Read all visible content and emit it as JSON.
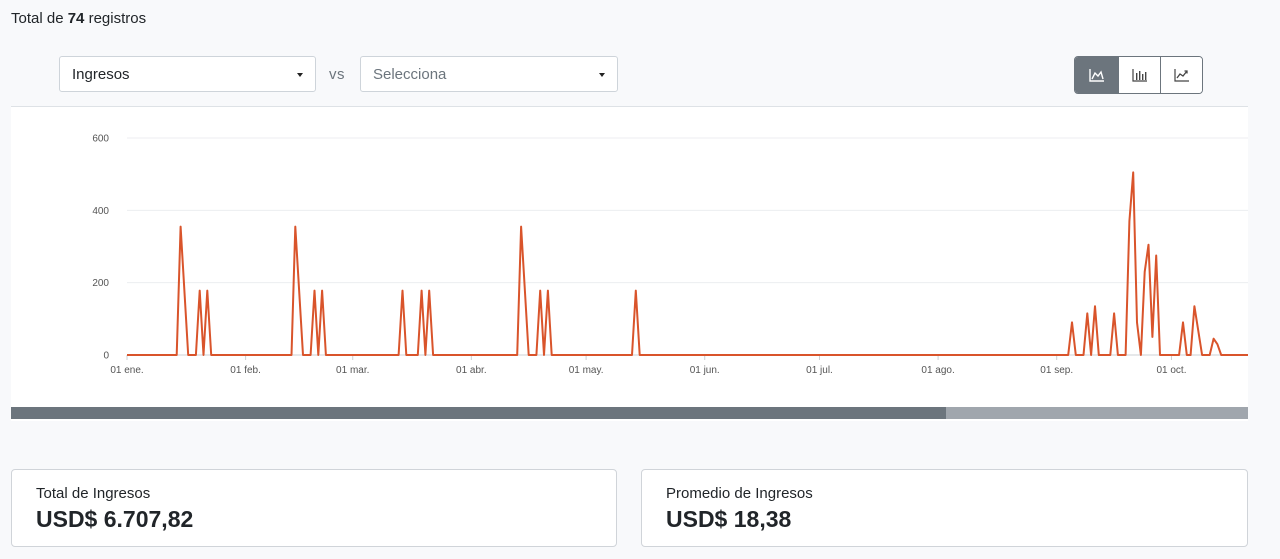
{
  "header": {
    "prefix": "Total de",
    "count": "74",
    "suffix": "registros"
  },
  "filters": {
    "metric_a": "Ingresos",
    "vs_label": "vs",
    "metric_b_placeholder": "Selecciona"
  },
  "chart_toggle": {
    "buttons": [
      {
        "icon": "area-chart-icon",
        "active": true
      },
      {
        "icon": "bar-chart-icon",
        "active": false
      },
      {
        "icon": "line-chart-icon",
        "active": false
      }
    ]
  },
  "chart_data": {
    "type": "line",
    "color": "#d9542b",
    "ylim": [
      0,
      600
    ],
    "y_ticks": [
      0,
      200,
      400,
      600
    ],
    "x_ticks": [
      "01 ene.",
      "01 feb.",
      "01 mar.",
      "01 abr.",
      "01 may.",
      "01 jun.",
      "01 jul.",
      "01 ago.",
      "01 sep.",
      "01 oct."
    ],
    "x_start": "2023-01-01",
    "x_end": "2023-10-21",
    "series": [
      {
        "values_by_date": [
          [
            "2023-01-01",
            0
          ],
          [
            "2023-01-14",
            0
          ],
          [
            "2023-01-15",
            355
          ],
          [
            "2023-01-17",
            0
          ],
          [
            "2023-01-19",
            0
          ],
          [
            "2023-01-20",
            178
          ],
          [
            "2023-01-21",
            0
          ],
          [
            "2023-01-22",
            178
          ],
          [
            "2023-01-23",
            0
          ],
          [
            "2023-02-13",
            0
          ],
          [
            "2023-02-14",
            355
          ],
          [
            "2023-02-16",
            0
          ],
          [
            "2023-02-18",
            0
          ],
          [
            "2023-02-19",
            178
          ],
          [
            "2023-02-20",
            0
          ],
          [
            "2023-02-21",
            178
          ],
          [
            "2023-02-22",
            0
          ],
          [
            "2023-03-13",
            0
          ],
          [
            "2023-03-14",
            178
          ],
          [
            "2023-03-15",
            0
          ],
          [
            "2023-03-18",
            0
          ],
          [
            "2023-03-19",
            178
          ],
          [
            "2023-03-20",
            0
          ],
          [
            "2023-03-21",
            178
          ],
          [
            "2023-03-22",
            0
          ],
          [
            "2023-04-13",
            0
          ],
          [
            "2023-04-14",
            355
          ],
          [
            "2023-04-16",
            0
          ],
          [
            "2023-04-18",
            0
          ],
          [
            "2023-04-19",
            178
          ],
          [
            "2023-04-20",
            0
          ],
          [
            "2023-04-21",
            178
          ],
          [
            "2023-04-22",
            0
          ],
          [
            "2023-05-13",
            0
          ],
          [
            "2023-05-14",
            178
          ],
          [
            "2023-05-15",
            0
          ],
          [
            "2023-09-04",
            0
          ],
          [
            "2023-09-05",
            90
          ],
          [
            "2023-09-06",
            0
          ],
          [
            "2023-09-08",
            0
          ],
          [
            "2023-09-09",
            115
          ],
          [
            "2023-09-10",
            0
          ],
          [
            "2023-09-11",
            135
          ],
          [
            "2023-09-12",
            0
          ],
          [
            "2023-09-15",
            0
          ],
          [
            "2023-09-16",
            115
          ],
          [
            "2023-09-17",
            0
          ],
          [
            "2023-09-19",
            0
          ],
          [
            "2023-09-20",
            370
          ],
          [
            "2023-09-21",
            505
          ],
          [
            "2023-09-22",
            90
          ],
          [
            "2023-09-23",
            0
          ],
          [
            "2023-09-24",
            230
          ],
          [
            "2023-09-25",
            305
          ],
          [
            "2023-09-26",
            50
          ],
          [
            "2023-09-27",
            275
          ],
          [
            "2023-09-28",
            0
          ],
          [
            "2023-10-03",
            0
          ],
          [
            "2023-10-04",
            90
          ],
          [
            "2023-10-05",
            0
          ],
          [
            "2023-10-06",
            0
          ],
          [
            "2023-10-07",
            135
          ],
          [
            "2023-10-09",
            0
          ],
          [
            "2023-10-11",
            0
          ],
          [
            "2023-10-12",
            45
          ],
          [
            "2023-10-13",
            30
          ],
          [
            "2023-10-14",
            0
          ],
          [
            "2023-10-21",
            0
          ]
        ]
      }
    ]
  },
  "cards": {
    "total_label": "Total de Ingresos",
    "total_value": "USD$ 6.707,82",
    "avg_label": "Promedio de Ingresos",
    "avg_value": "USD$ 18,38"
  }
}
